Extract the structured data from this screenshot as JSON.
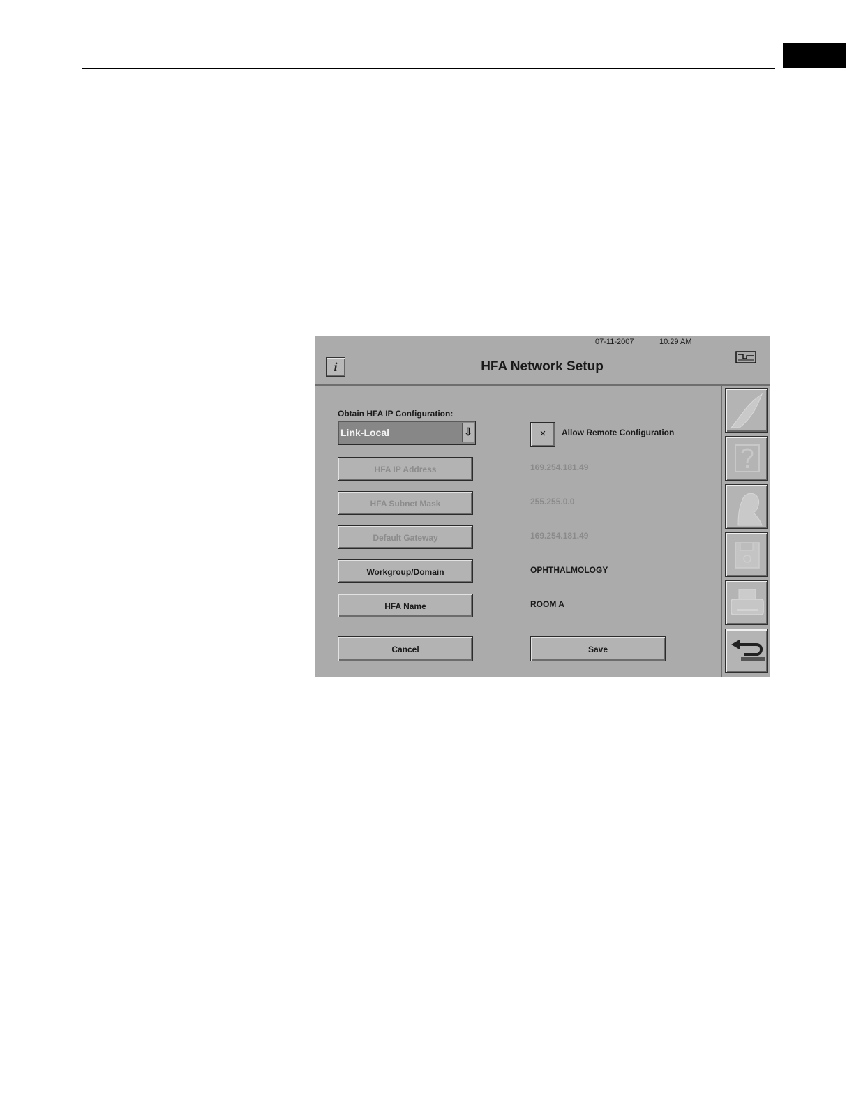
{
  "header": {
    "date": "07-11-2007",
    "time": "10:29 AM",
    "title": "HFA Network Setup"
  },
  "icons": {
    "info": "i",
    "dropdown_arrow": "⇩",
    "checkbox_mark": "×"
  },
  "ip_config": {
    "label": "Obtain HFA IP Configuration:",
    "selected": "Link-Local"
  },
  "remote": {
    "checked": true,
    "label": "Allow Remote Configuration"
  },
  "fields": [
    {
      "button_label": "HFA IP Address",
      "value": "169.254.181.49",
      "enabled": false
    },
    {
      "button_label": "HFA Subnet Mask",
      "value": "255.255.0.0",
      "enabled": false
    },
    {
      "button_label": "Default Gateway",
      "value": "169.254.181.49",
      "enabled": false
    },
    {
      "button_label": "Workgroup/Domain",
      "value": "OPHTHALMOLOGY",
      "enabled": true
    },
    {
      "button_label": "HFA Name",
      "value": "ROOM A",
      "enabled": true
    }
  ],
  "actions": {
    "cancel_label": "Cancel",
    "save_label": "Save"
  },
  "toolbar": [
    {
      "icon": "swoosh-icon",
      "enabled": false
    },
    {
      "icon": "help-icon",
      "enabled": false
    },
    {
      "icon": "patient-icon",
      "enabled": false
    },
    {
      "icon": "floppy-disk-icon",
      "enabled": false
    },
    {
      "icon": "printer-icon",
      "enabled": false
    },
    {
      "icon": "return-arrow-icon",
      "enabled": true
    }
  ],
  "colors": {
    "panel_background": "#ababab",
    "disabled_text": "#8a8a8a",
    "dropdown_background": "#878787"
  }
}
